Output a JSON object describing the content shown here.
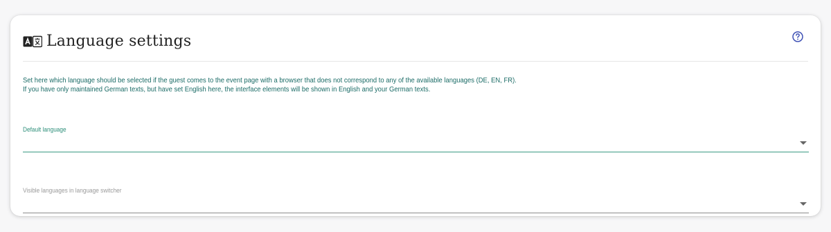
{
  "card": {
    "title": "Language settings",
    "title_icon": "language-icon",
    "help_icon": "help-circle-icon"
  },
  "description": {
    "line1": "Set here which language should be selected if the guest comes to the event page with a browser that does not correspond to any of the available languages (DE, EN, FR).",
    "line2": "If you have only maintained German texts, but have set English here, the interface elements will be shown in English and your German texts."
  },
  "fields": {
    "default_language": {
      "label": "Default language",
      "value": "",
      "icon": "chevron-down-icon"
    },
    "visible_languages": {
      "label": "Visible languages in language switcher",
      "value": "",
      "icon": "chevron-down-icon"
    }
  },
  "colors": {
    "accent": "#3a9a82",
    "description_text": "#1a6b66",
    "help_icon": "#3f51b5"
  }
}
